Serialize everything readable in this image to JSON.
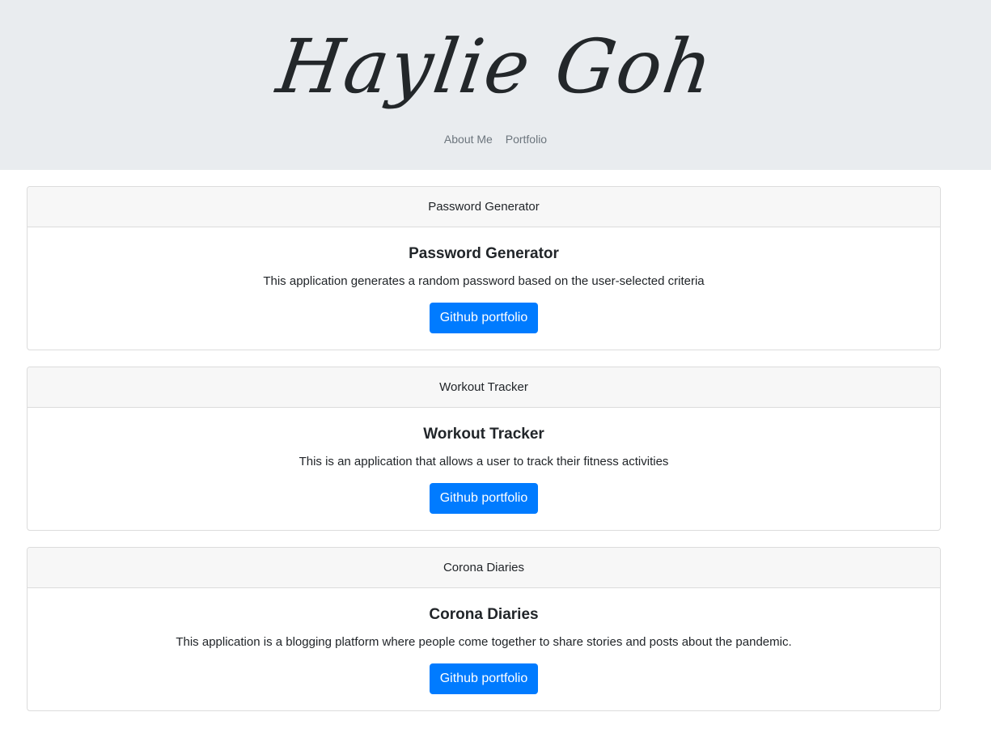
{
  "header": {
    "title": "Haylie Goh",
    "nav": [
      {
        "label": "About Me"
      },
      {
        "label": "Portfolio"
      }
    ]
  },
  "projects": [
    {
      "header": "Password Generator",
      "title": "Password Generator",
      "description": "This application generates a random password based on the user-selected criteria",
      "button_label": "Github portfolio"
    },
    {
      "header": "Workout Tracker",
      "title": "Workout Tracker",
      "description": "This is an application that allows a user to track their fitness activities",
      "button_label": "Github portfolio"
    },
    {
      "header": "Corona Diaries",
      "title": "Corona Diaries",
      "description": "This application is a blogging platform where people come together to share stories and posts about the pandemic.",
      "button_label": "Github portfolio"
    }
  ],
  "colors": {
    "header_bg": "#e9ecef",
    "button_bg": "#007bff",
    "nav_link": "#6c757d"
  }
}
